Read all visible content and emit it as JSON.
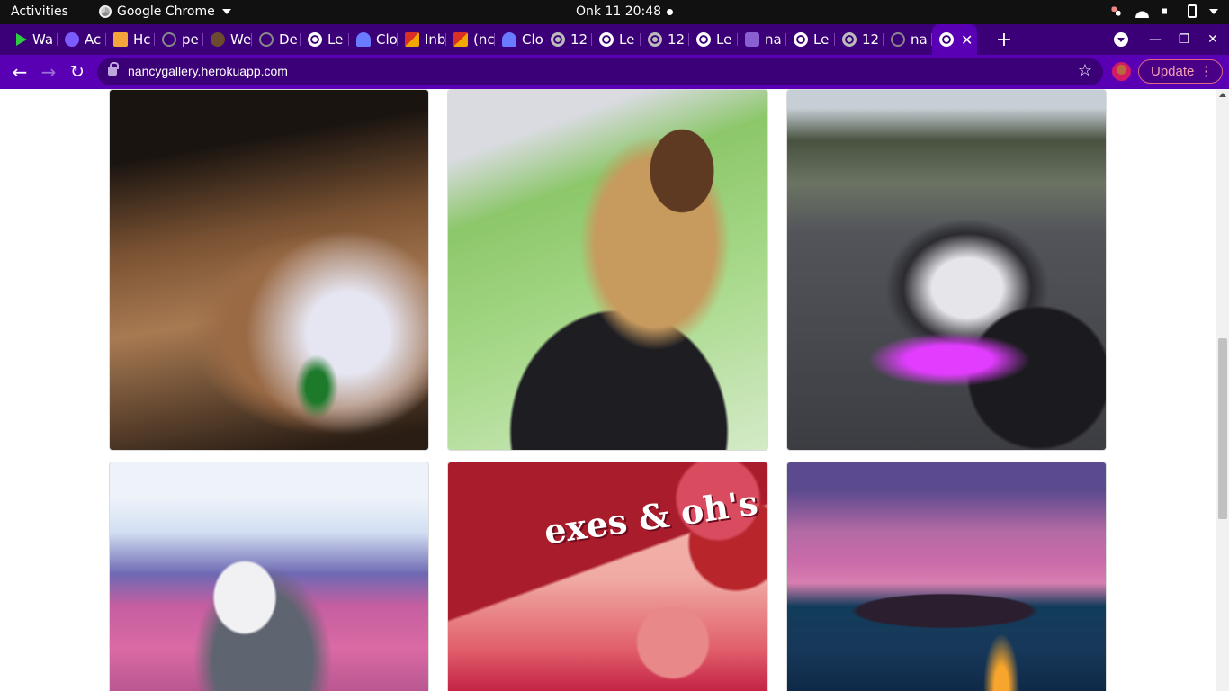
{
  "system_bar": {
    "activities": "Activities",
    "app_name": "Google Chrome",
    "clock": "Onk 11  20:48"
  },
  "tabs": [
    {
      "title": "Wa",
      "icon": "play-icon"
    },
    {
      "title": "Ac",
      "icon": "purple-circle-icon"
    },
    {
      "title": "Hc",
      "icon": "hc-icon"
    },
    {
      "title": "pe",
      "icon": "github-icon"
    },
    {
      "title": "We",
      "icon": "tree-icon"
    },
    {
      "title": "De",
      "icon": "github-icon"
    },
    {
      "title": "Le",
      "icon": "globe-icon"
    },
    {
      "title": "Clo",
      "icon": "cloud-icon"
    },
    {
      "title": "Inb",
      "icon": "gmail-icon"
    },
    {
      "title": "(nc",
      "icon": "gmail-icon"
    },
    {
      "title": "Clo",
      "icon": "cloud-icon"
    },
    {
      "title": "12",
      "icon": "globe-icon"
    },
    {
      "title": "Le",
      "icon": "globe-icon"
    },
    {
      "title": "12",
      "icon": "globe-icon"
    },
    {
      "title": "Le",
      "icon": "globe-icon"
    },
    {
      "title": "na",
      "icon": "heroku-icon"
    },
    {
      "title": "Le",
      "icon": "globe-icon"
    },
    {
      "title": "12",
      "icon": "globe-icon"
    },
    {
      "title": "na",
      "icon": "github-icon"
    }
  ],
  "active_tab": {
    "icon": "globe-icon",
    "close": "✕"
  },
  "new_tab_label": "+",
  "window_controls": {
    "minimize": "—",
    "maximize": "❐",
    "close": "✕"
  },
  "toolbar": {
    "url": "nancygallery.herokuapp.com",
    "update_label": "Update",
    "menu_label": "⋮"
  },
  "gallery": [
    {
      "subject": "jewelry-photo",
      "text": ""
    },
    {
      "subject": "selfie-photo",
      "text": ""
    },
    {
      "subject": "motorcycle-photo",
      "text": ""
    },
    {
      "subject": "husky-photo",
      "text": ""
    },
    {
      "subject": "makeup-photo",
      "text": "exes & oh's"
    },
    {
      "subject": "sunset-villas-photo",
      "text": ""
    }
  ],
  "colors": {
    "tab_strip": "#3b0078",
    "toolbar": "#5a00b4",
    "update_border": "#e06a84"
  }
}
